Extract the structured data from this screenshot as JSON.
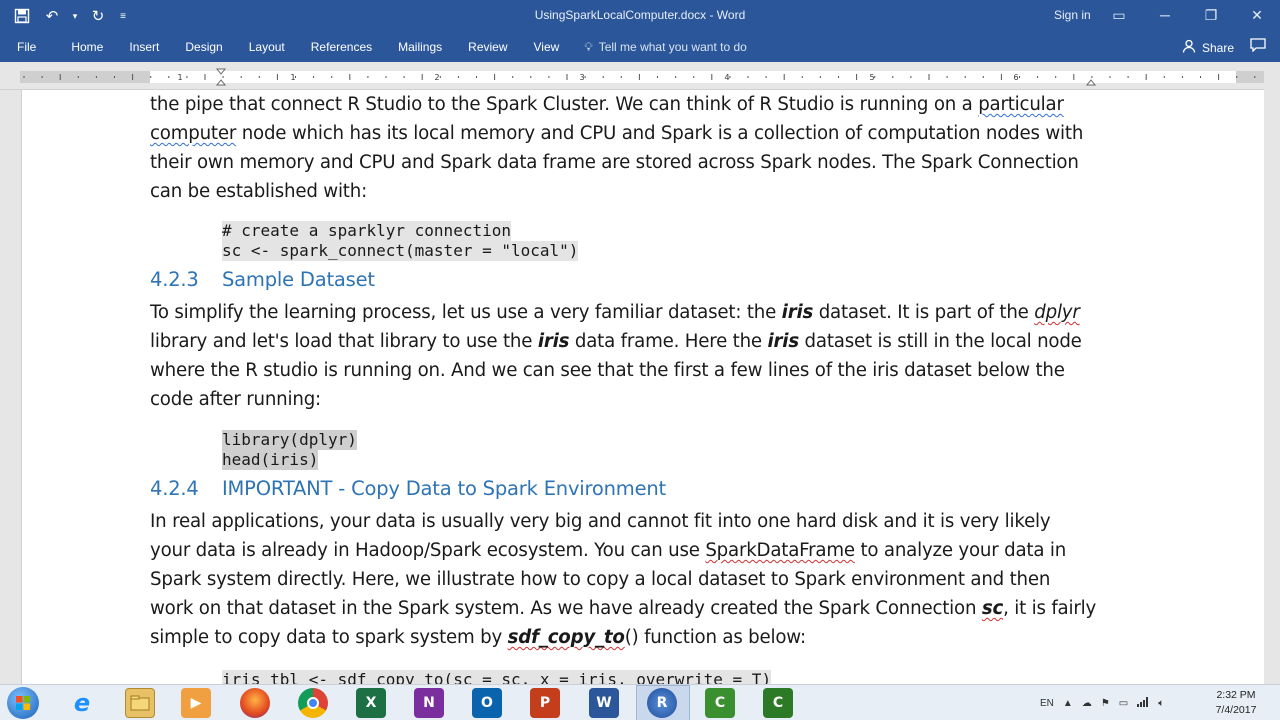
{
  "window": {
    "title": "UsingSparkLocalComputer.docx  -  Word",
    "signin": "Sign in"
  },
  "ribbon": {
    "tabs": [
      "File",
      "Home",
      "Insert",
      "Design",
      "Layout",
      "References",
      "Mailings",
      "Review",
      "View"
    ],
    "tell_me": "Tell me what you want to do",
    "share": "Share"
  },
  "ruler": {
    "numbers": [
      "1",
      "1",
      "2",
      "3",
      "4",
      "5",
      "6"
    ]
  },
  "document": {
    "para1": {
      "lines": [
        "the pipe that connect R Studio to the Spark Cluster. We can think of R Studio is running on a particular",
        "computer node which has its local memory and CPU and Spark is a collection of computation nodes with",
        "their own memory and CPU and Spark data frame are stored across Spark nodes. The Spark Connection",
        "can be established with:"
      ]
    },
    "code1": {
      "line1": "# create a sparklyr connection",
      "line2": "sc <- spark_connect(master = \"local\")"
    },
    "heading1": {
      "number": "4.2.3",
      "title": "Sample Dataset"
    },
    "para2": {
      "lines": [
        "To simplify the learning process, let us use a very familiar dataset: the iris dataset. It is part of the dplyr",
        "library and let's load that library to use the iris data frame. Here the iris dataset is still in the local node",
        "where the R studio is running on. And we can see that the first a few lines of the iris dataset below the",
        "code after running:"
      ]
    },
    "code2": {
      "line1": "library(dplyr)",
      "line2": "head(iris)"
    },
    "heading2": {
      "number": "4.2.4",
      "title": "IMPORTANT - Copy Data to Spark Environment"
    },
    "para3": {
      "lines": [
        "In real applications, your data is usually very big and cannot fit into one hard disk and it is very likely",
        "your data is already in Hadoop/Spark ecosystem. You can use SparkDataFrame to analyze your data in",
        "Spark system directly. Here, we illustrate how to copy a local dataset to Spark environment and then",
        "work on that dataset in the Spark system. As we have already created the Spark Connection sc, it is fairly",
        "simple to copy data to spark system by sdf_copy_to() function as below:"
      ]
    },
    "code3": {
      "line1": "iris_tbl <- sdf_copy_to(sc = sc, x = iris, overwrite = T)"
    }
  },
  "taskbar": {
    "apps": [
      "start-orb",
      "internet-explorer",
      "file-explorer",
      "media-player",
      "firefox",
      "chrome",
      "excel",
      "onenote",
      "outlook",
      "powerpoint",
      "word",
      "r",
      "camtasia",
      "camtasia-recorder"
    ],
    "language": "EN",
    "time": "2:32 PM",
    "date": "7/4/2017"
  },
  "colors": {
    "ribbon": "#2b579a",
    "heading": "#2e74b5",
    "taskbar": "#e8eef6"
  }
}
